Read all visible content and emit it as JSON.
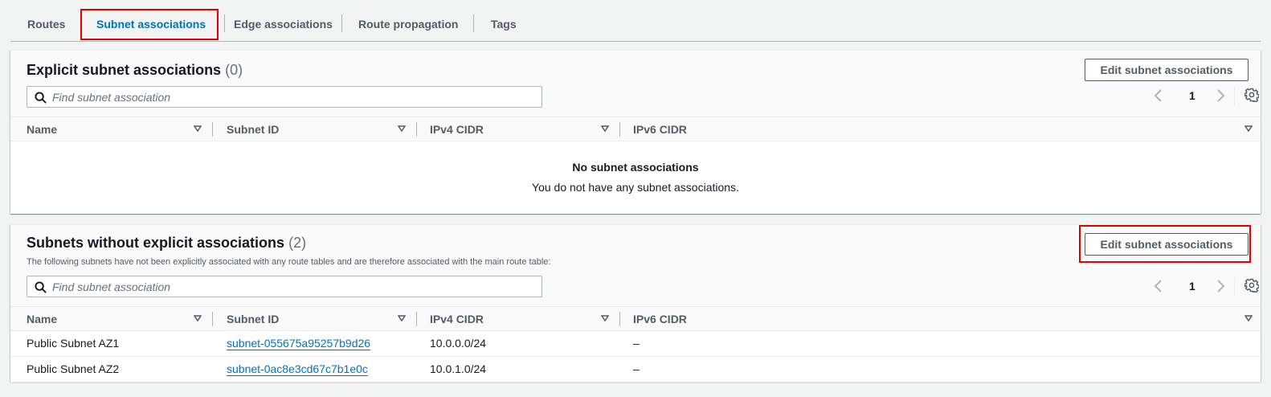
{
  "tabs": [
    {
      "label": "Routes"
    },
    {
      "label": "Subnet associations"
    },
    {
      "label": "Edge associations"
    },
    {
      "label": "Route propagation"
    },
    {
      "label": "Tags"
    }
  ],
  "explicit": {
    "title": "Explicit subnet associations",
    "count": "(0)",
    "edit_button": "Edit subnet associations",
    "search_placeholder": "Find subnet association",
    "page": "1",
    "columns": [
      "Name",
      "Subnet ID",
      "IPv4 CIDR",
      "IPv6 CIDR"
    ],
    "empty_title": "No subnet associations",
    "empty_message": "You do not have any subnet associations."
  },
  "implicit": {
    "title": "Subnets without explicit associations",
    "count": "(2)",
    "description": "The following subnets have not been explicitly associated with any route tables and are therefore associated with the main route table:",
    "edit_button": "Edit subnet associations",
    "search_placeholder": "Find subnet association",
    "page": "1",
    "columns": [
      "Name",
      "Subnet ID",
      "IPv4 CIDR",
      "IPv6 CIDR"
    ],
    "rows": [
      {
        "name": "Public Subnet AZ1",
        "subnet_id": "subnet-055675a95257b9d26",
        "ipv4": "10.0.0.0/24",
        "ipv6": "–"
      },
      {
        "name": "Public Subnet AZ2",
        "subnet_id": "subnet-0ac8e3cd67c7b1e0c",
        "ipv4": "10.0.1.0/24",
        "ipv6": "–"
      }
    ]
  },
  "colors": {
    "accent": "#0073bb",
    "highlight": "#e00000",
    "text_secondary": "#545b64"
  }
}
